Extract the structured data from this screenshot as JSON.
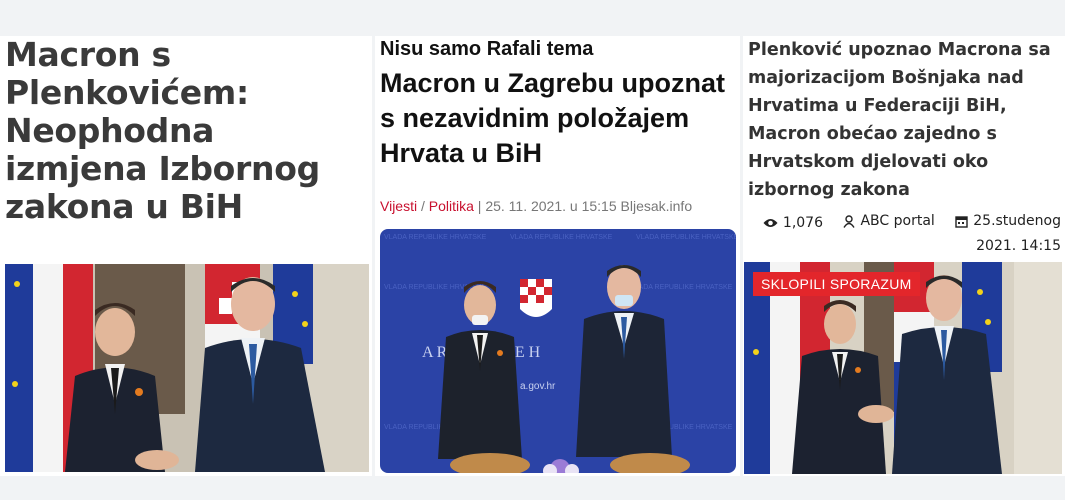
{
  "panel1": {
    "title": "Macron s Plenkovićem: Neophodna izmjena Izbornog zakona u BiH"
  },
  "panel2": {
    "kicker": "Nisu samo Rafali tema",
    "title": "Macron u Zagrebu upoznat s nezavidnim položajem Hrvata u BiH",
    "meta": {
      "cat1": "Vijesti",
      "sep1": " / ",
      "cat2": "Politika",
      "rest": " | 25. 11. 2021. u 15:15 Bljesak.info"
    },
    "backdrop_text": "VLADA REPUBLIKE HRVATSKE",
    "backdrop_big": "UBLIKE H",
    "backdrop_big2": "A REPUBLIKE H",
    "backdrop_url": "a.gov.hr"
  },
  "panel3": {
    "title": "Plenković upoznao Macrona sa majorizacijom Bošnjaka nad Hrvatima u Federaciji BiH, Macron obećao zajedno s Hrvatskom djelovati oko izbornog zakona",
    "views": "1,076",
    "author": "ABC portal",
    "date": "25.studenog",
    "time": "2021. 14:15",
    "badge": "SKLOPILI SPORAZUM"
  },
  "colors": {
    "accent_red": "#e3262b",
    "category_red": "#c8102e",
    "backdrop_blue": "#2b43a6"
  }
}
